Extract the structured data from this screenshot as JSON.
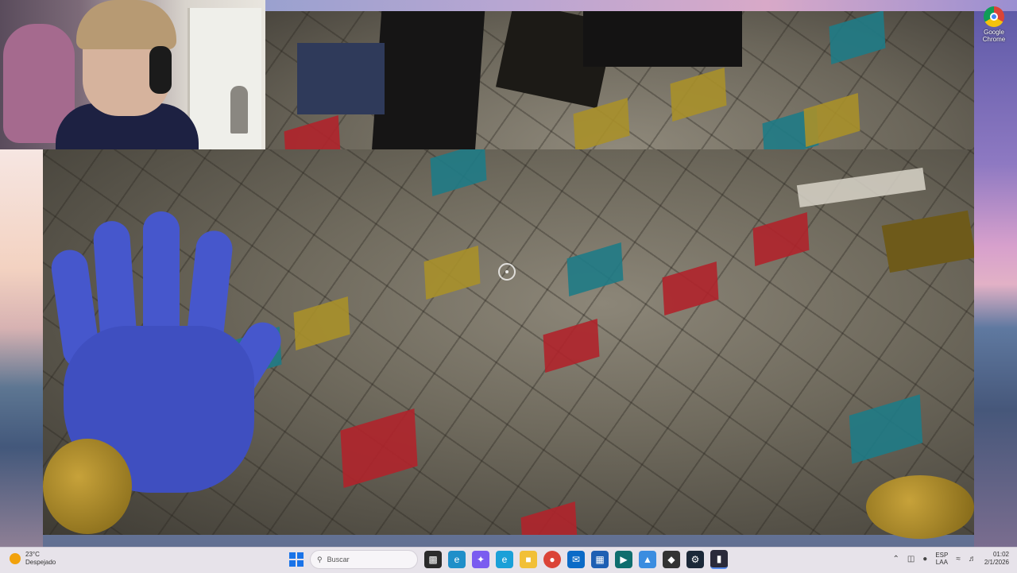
{
  "desktop": {
    "icons": [
      {
        "label": "Google Chrome",
        "icon": "chrome-icon"
      }
    ]
  },
  "game": {
    "tile_colors": {
      "red": "#b0232b",
      "yellow": "#a8902a",
      "teal": "#1f7b86"
    },
    "hand_color": "#4657cc"
  },
  "taskbar": {
    "weather": {
      "temp": "23°C",
      "condition": "Despejado"
    },
    "search": {
      "placeholder": "Buscar"
    },
    "pinned_apps": [
      "explorer-icon",
      "edge-icon",
      "copilot-icon",
      "edge-alt-icon",
      "folder-icon",
      "chrome-icon",
      "outlook-icon",
      "store-icon",
      "game-icon",
      "photos-icon",
      "roblox-icon",
      "steam-icon",
      "terminal-icon"
    ],
    "tray": {
      "lang_line1": "ESP",
      "lang_line2": "LAA",
      "time": "01:02",
      "date": "2/1/2026"
    }
  }
}
